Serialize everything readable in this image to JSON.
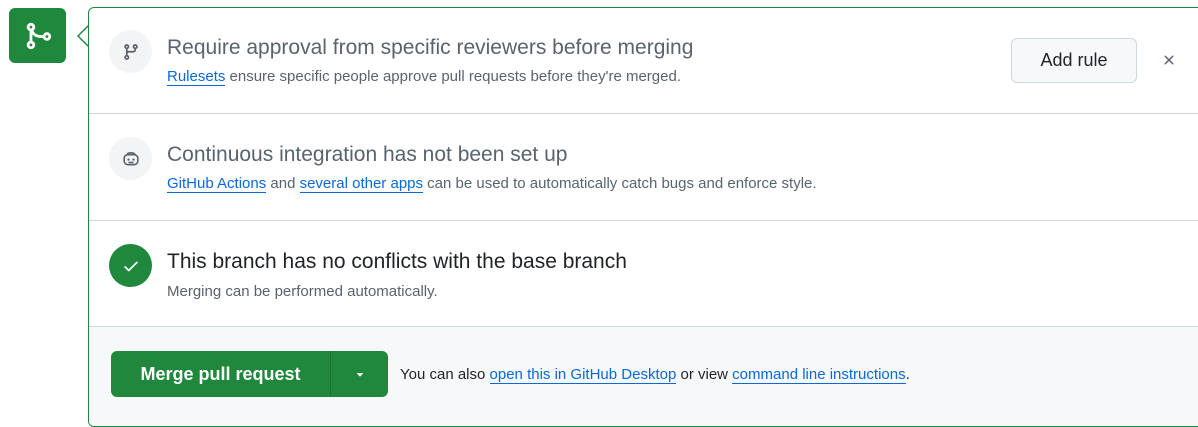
{
  "rulesets": {
    "icon": "git-branch-icon",
    "title": "Require approval from specific reviewers before merging",
    "link_text": "Rulesets",
    "desc_rest": " ensure specific people approve pull requests before they're merged.",
    "add_rule_label": "Add rule",
    "close_label": "×"
  },
  "ci": {
    "icon": "copilot-robot-icon",
    "title": "Continuous integration has not been set up",
    "link1_text": "GitHub Actions",
    "mid_text": " and ",
    "link2_text": "several other apps",
    "desc_rest": " can be used to automatically catch bugs and enforce style."
  },
  "conflicts": {
    "icon": "check-icon",
    "title": "This branch has no conflicts with the base branch",
    "desc": "Merging can be performed automatically."
  },
  "merge": {
    "button_label": "Merge pull request",
    "hint_prefix": "You can also ",
    "link1_text": "open this in GitHub Desktop",
    "hint_mid": " or view ",
    "link2_text": "command line instructions",
    "hint_suffix": "."
  },
  "colors": {
    "success": "#1f883d",
    "link": "#0969da",
    "muted": "#59636e",
    "border": "#d0d7de"
  }
}
